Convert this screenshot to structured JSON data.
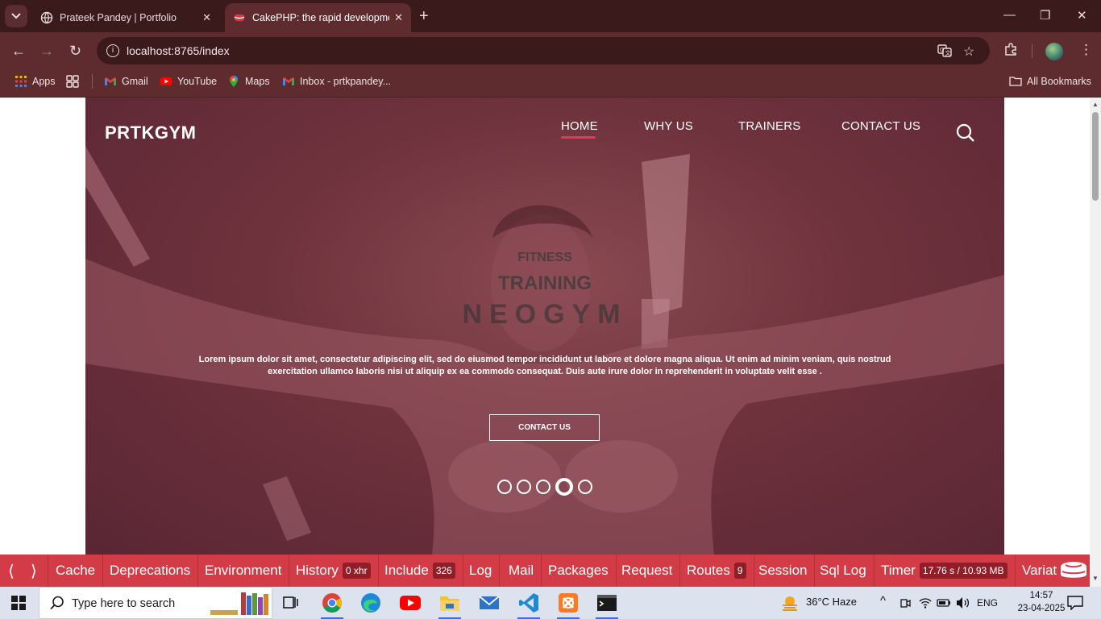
{
  "browser": {
    "tabs": [
      {
        "title": "Prateek Pandey | Portfolio",
        "active": false
      },
      {
        "title": "CakePHP: the rapid development php framework",
        "active": true
      }
    ],
    "url": "localhost:8765/index",
    "bookmarks": [
      {
        "label": "Apps",
        "icon": "apps-grid-icon"
      },
      {
        "label": "",
        "icon": "tab-groups-icon"
      },
      {
        "label": "Gmail",
        "icon": "gmail-icon"
      },
      {
        "label": "YouTube",
        "icon": "youtube-icon"
      },
      {
        "label": "Maps",
        "icon": "maps-icon"
      },
      {
        "label": "Inbox - prtkpandey...",
        "icon": "gmail-icon"
      }
    ],
    "all_bookmarks": "All Bookmarks"
  },
  "site": {
    "brand": "PRTKGYM",
    "nav": [
      "HOME",
      "WHY US",
      "TRAINERS",
      "CONTACT US"
    ],
    "active_nav": "HOME",
    "hero": {
      "eyebrow": "FITNESS",
      "title": "TRAINING",
      "brand": "NEOGYM",
      "body": "Lorem ipsum dolor sit amet, consectetur adipiscing elit, sed do eiusmod tempor incididunt ut labore et dolore magna aliqua. Ut enim ad minim veniam, quis nostrud exercitation ullamco laboris nisi ut aliquip ex ea commodo consequat. Duis aute irure dolor in reprehenderit in voluptate velit esse .",
      "cta": "CONTACT US",
      "slides": 5,
      "active_slide": 4
    },
    "colors": {
      "accent": "#e8365a",
      "overlay": "#6e323c"
    }
  },
  "debugkit": {
    "panels": [
      {
        "label": "Cache"
      },
      {
        "label": "Deprecations"
      },
      {
        "label": "Environment"
      },
      {
        "label": "History",
        "badge": "0 xhr"
      },
      {
        "label": "Include",
        "badge": "326"
      },
      {
        "label": "Log"
      },
      {
        "label": "Mail"
      },
      {
        "label": "Packages"
      },
      {
        "label": "Request"
      },
      {
        "label": "Routes",
        "badge": "9"
      },
      {
        "label": "Session"
      },
      {
        "label": "Sql Log"
      },
      {
        "label": "Timer",
        "badge": "17.76 s / 10.93 MB"
      },
      {
        "label": "Variat"
      }
    ],
    "color": "#d33c47"
  },
  "taskbar": {
    "search_placeholder": "Type here to search",
    "weather": "36°C  Haze",
    "language": "ENG",
    "time": "14:57",
    "date": "23-04-2025"
  }
}
